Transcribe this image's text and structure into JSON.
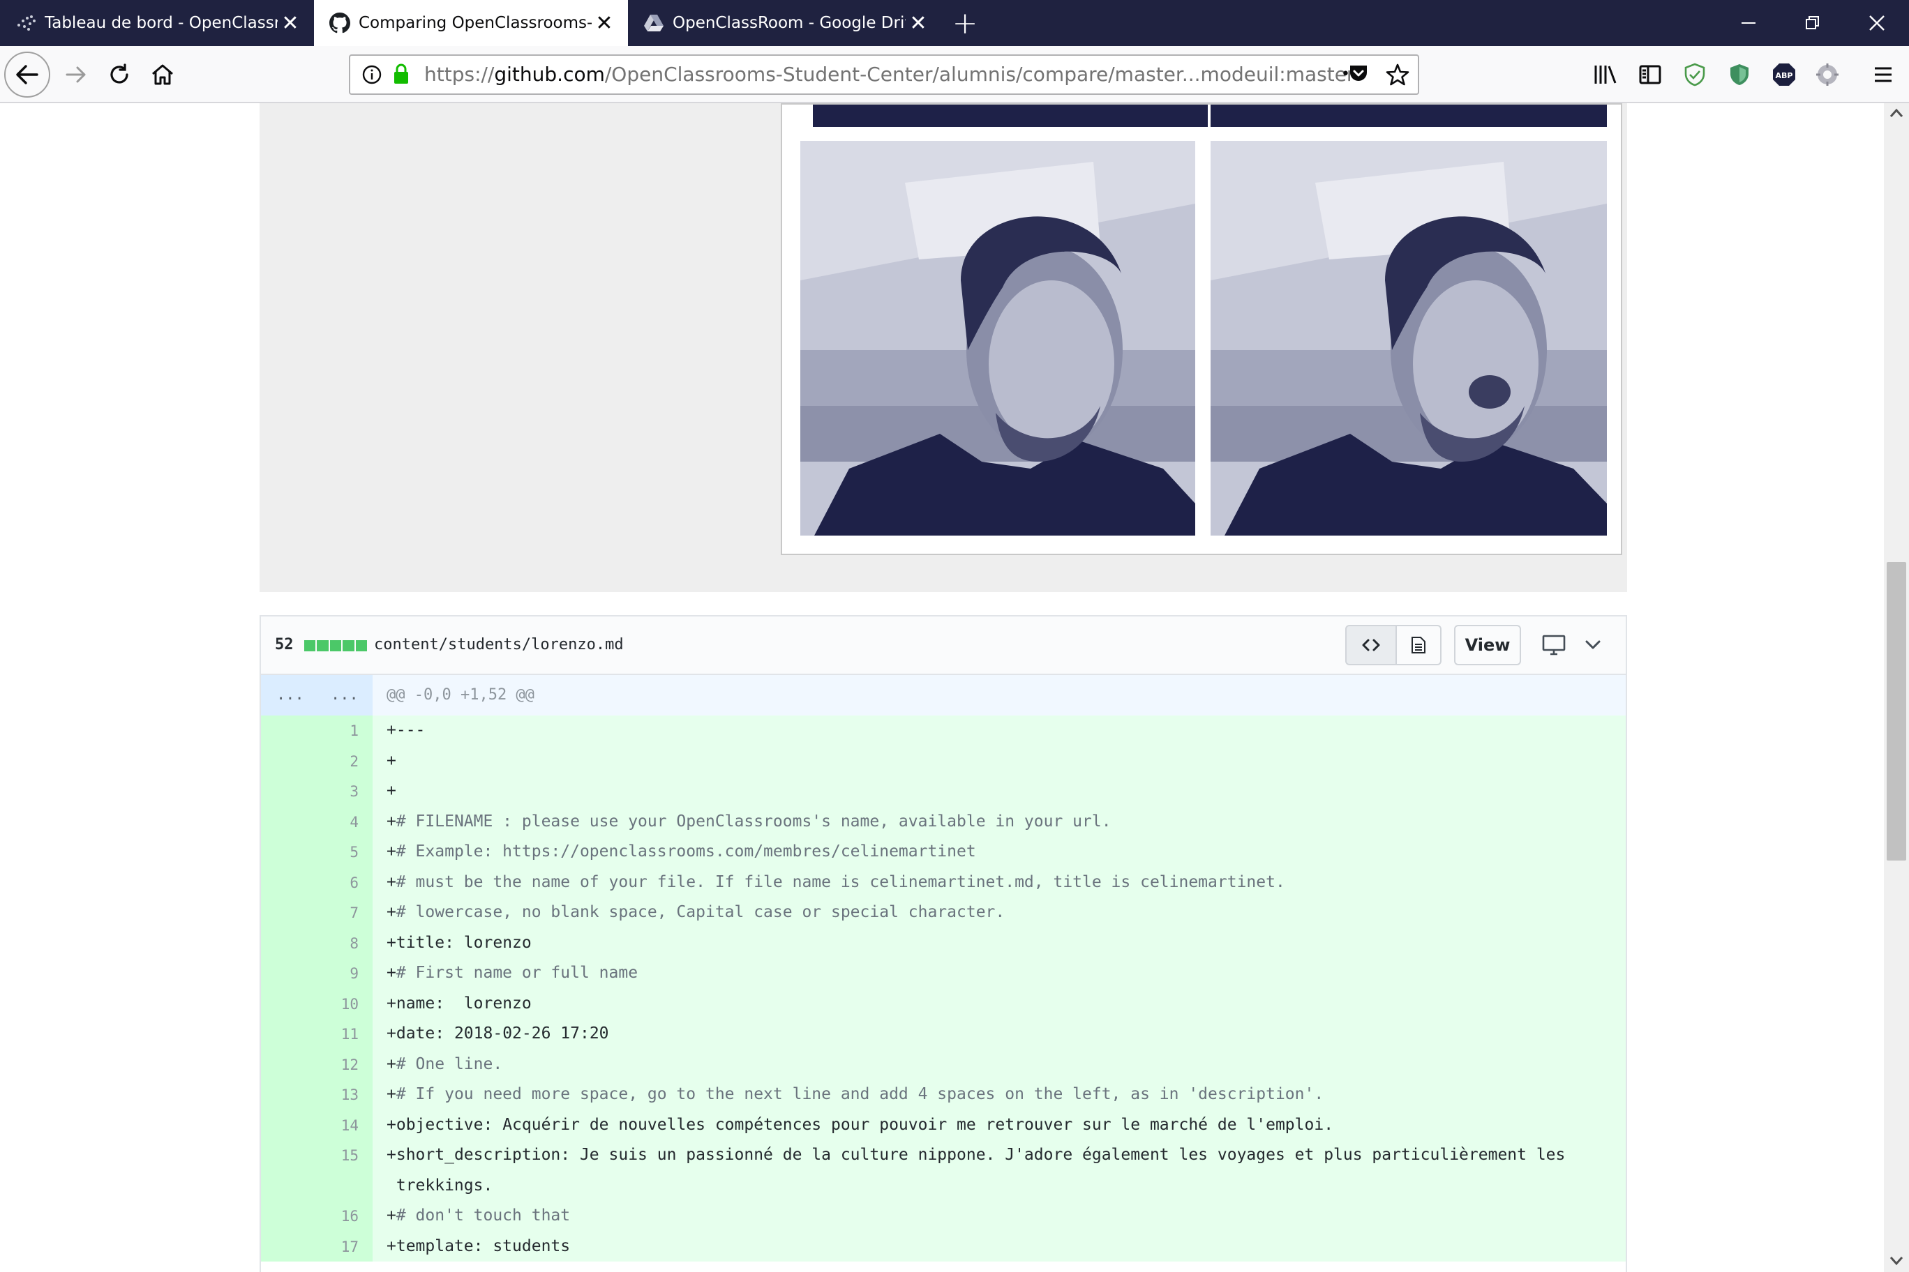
{
  "tabs": [
    {
      "title": "Tableau de bord - OpenClassrc",
      "icon": "openclassrooms-icon",
      "active": false
    },
    {
      "title": "Comparing OpenClassrooms-S",
      "icon": "github-icon",
      "active": true
    },
    {
      "title": "OpenClassRoom - Google Driv",
      "icon": "google-drive-icon",
      "active": false
    }
  ],
  "tab_close_glyph": "✕",
  "new_tab_glyph": "+",
  "url": {
    "prefix": "https://",
    "host": "github.com",
    "path": "/OpenClassrooms-Student-Center/alumnis/compare/master...modeuil:master"
  },
  "url_more_glyph": "•••",
  "file": {
    "stat": "52",
    "path": "content/students/lorenzo.md",
    "view_label": "View"
  },
  "diff": {
    "hunk_gutter_left": "...",
    "hunk_gutter_right": "...",
    "hunk_header": "@@ -0,0 +1,52 @@",
    "lines": [
      {
        "num": "1",
        "plus": "+",
        "key": "---",
        "value": ""
      },
      {
        "num": "2",
        "plus": "+",
        "key": "",
        "value": ""
      },
      {
        "num": "3",
        "plus": "+",
        "key": "",
        "value": ""
      },
      {
        "num": "4",
        "plus": "+",
        "key": "# FILENAME : please use your OpenClassrooms's name, available in your url.",
        "value": "",
        "comment": true
      },
      {
        "num": "5",
        "plus": "+",
        "key": "# Example: https://openclassrooms.com/membres/celinemartinet",
        "value": "",
        "comment": true
      },
      {
        "num": "6",
        "plus": "+",
        "key": "# must be the name of your file. If file name is celinemartinet.md, title is celinemartinet.",
        "value": "",
        "comment": true
      },
      {
        "num": "7",
        "plus": "+",
        "key": "# lowercase, no blank space, Capital case or special character.",
        "value": "",
        "comment": true
      },
      {
        "num": "8",
        "plus": "+",
        "key": "title:",
        "value": " lorenzo"
      },
      {
        "num": "9",
        "plus": "+",
        "key": "# First name or full name",
        "value": "",
        "comment": true
      },
      {
        "num": "10",
        "plus": "+",
        "key": "name:",
        "value": "  lorenzo"
      },
      {
        "num": "11",
        "plus": "+",
        "key": "date:",
        "value": " 2018-02-26 17:20"
      },
      {
        "num": "12",
        "plus": "+",
        "key": "# One line.",
        "value": "",
        "comment": true
      },
      {
        "num": "13",
        "plus": "+",
        "key": "# If you need more space, go to the next line and add 4 spaces on the left, as in 'description'.",
        "value": "",
        "comment": true
      },
      {
        "num": "14",
        "plus": "+",
        "key": "objective:",
        "value": " Acquérir de nouvelles compétences pour pouvoir me retrouver sur le marché de l'emploi."
      },
      {
        "num": "15",
        "plus": "+",
        "key": "short_description:",
        "value": " Je suis un passionné de la culture nippone. J'adore également les voyages et plus particulièrement les",
        "cont": " trekkings."
      },
      {
        "num": "16",
        "plus": "+",
        "key": "# don't touch that",
        "value": "",
        "comment": true
      },
      {
        "num": "17",
        "plus": "+",
        "key": "template:",
        "value": " students"
      }
    ]
  },
  "colors": {
    "tabbar": "#1f2240",
    "added_line": "#e6ffed",
    "added_gutter": "#cdffd8",
    "diffstat_green": "#2cbe4e"
  }
}
